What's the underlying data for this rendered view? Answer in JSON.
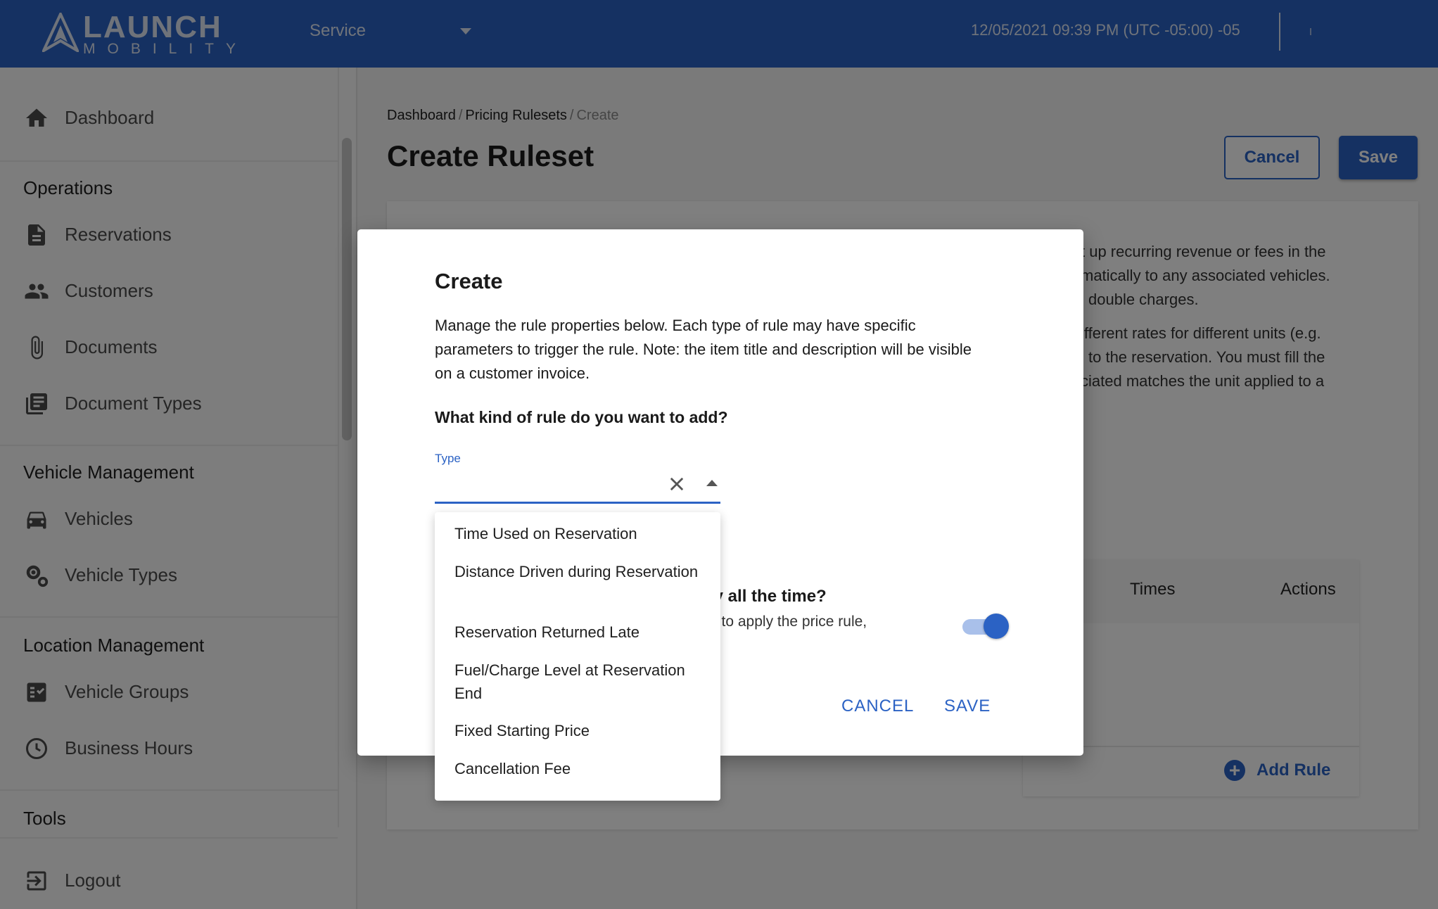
{
  "header": {
    "logo_text": "LAUNCH",
    "logo_subtext": "MOBILITY",
    "service_select": "Service",
    "datetime": "12/05/2021 09:39 PM (UTC -05:00) -05"
  },
  "sidebar": {
    "dashboard": "Dashboard",
    "sections": {
      "operations": "Operations",
      "vehicle_management": "Vehicle Management",
      "location_management": "Location Management",
      "tools": "Tools"
    },
    "items": {
      "reservations": "Reservations",
      "customers": "Customers",
      "documents": "Documents",
      "document_types": "Document Types",
      "vehicles": "Vehicles",
      "vehicle_types": "Vehicle Types",
      "vehicle_groups": "Vehicle Groups",
      "business_hours": "Business Hours"
    },
    "logout": "Logout"
  },
  "breadcrumb": {
    "items": [
      "Dashboard",
      "Pricing Rulesets"
    ],
    "current": "Create",
    "separator": "/"
  },
  "page": {
    "title": "Create Ruleset",
    "cancel_label": "Cancel",
    "save_label": "Save"
  },
  "card": {
    "description_lines": [
      "t up recurring revenue or fees in the",
      "matically to any associated vehicles.",
      "l double charges.",
      "ifferent rates for different units (e.g.",
      "l to the reservation. You must fill the",
      "ciated matches the unit applied to a"
    ],
    "table_headers": {
      "times": "Times",
      "actions": "Actions"
    },
    "add_rule_label": "Add Rule"
  },
  "modal": {
    "title": "Create",
    "description": "Manage the rule properties below. Each type of rule may have specific parameters to trigger the rule. Note: the item title and description will be visible on a customer invoice.",
    "question": "What kind of rule do you want to add?",
    "type_label": "Type",
    "toggle_question": "ly all the time?",
    "toggle_subtext": "e to apply the price rule,",
    "toggle_on": true,
    "cancel_label": "CANCEL",
    "save_label": "SAVE"
  },
  "dropdown": {
    "options": [
      "Time Used on Reservation",
      "Distance Driven during Reservation",
      "Reservation Returned Late",
      "Fuel/Charge Level at Reservation End",
      "Fixed Starting Price",
      "Cancellation Fee"
    ]
  },
  "colors": {
    "primary": "#2b62c4",
    "overlay": "rgba(0,0,0,0.5)"
  }
}
